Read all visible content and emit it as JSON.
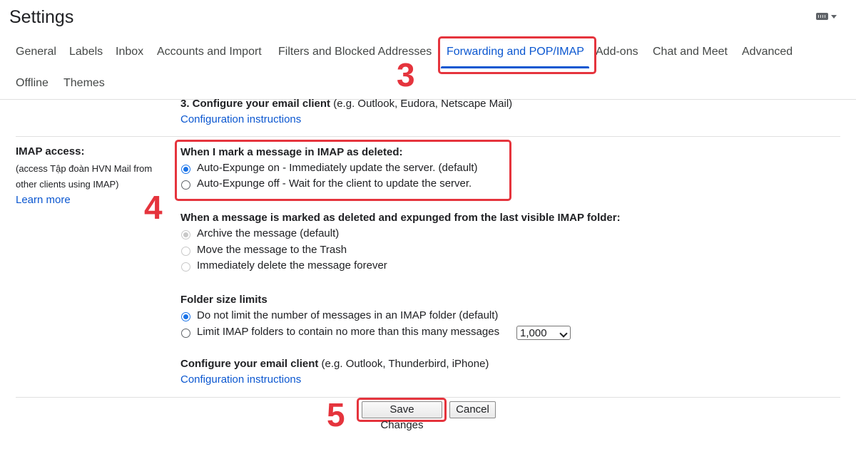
{
  "header": {
    "title": "Settings",
    "keyboard_icon": "keyboard-icon"
  },
  "tabs": [
    {
      "label": "General"
    },
    {
      "label": "Labels"
    },
    {
      "label": "Inbox"
    },
    {
      "label": "Accounts and Import"
    },
    {
      "label": "Filters and Blocked Addresses"
    },
    {
      "label": "Forwarding and POP/IMAP",
      "active": true
    },
    {
      "label": "Add-ons"
    },
    {
      "label": "Chat and Meet"
    },
    {
      "label": "Advanced"
    },
    {
      "label": "Offline"
    },
    {
      "label": "Themes"
    }
  ],
  "annotations": {
    "step3": "3",
    "step4": "4",
    "step5": "5",
    "color": "#e5343d"
  },
  "pop_section": {
    "configure_bold": "3. Configure your email client",
    "configure_rest": "(e.g. Outlook, Eudora, Netscape Mail)",
    "instructions_link": "Configuration instructions"
  },
  "imap": {
    "label": "IMAP access:",
    "description": "(access Tập đoàn HVN Mail from other clients using IMAP)",
    "learn_more": "Learn more",
    "deleted_heading": "When I mark a message in IMAP as deleted:",
    "deleted_options": [
      {
        "label": "Auto-Expunge on - Immediately update the server. (default)",
        "checked": true
      },
      {
        "label": "Auto-Expunge off - Wait for the client to update the server.",
        "checked": false
      }
    ],
    "expunged_heading": "When a message is marked as deleted and expunged from the last visible IMAP folder:",
    "expunged_options": [
      {
        "label": "Archive the message (default)",
        "checked": true,
        "disabled": true
      },
      {
        "label": "Move the message to the Trash",
        "checked": false,
        "disabled": true
      },
      {
        "label": "Immediately delete the message forever",
        "checked": false,
        "disabled": true
      }
    ],
    "folder_heading": "Folder size limits",
    "folder_options": [
      {
        "label": "Do not limit the number of messages in an IMAP folder (default)",
        "checked": true
      },
      {
        "label": "Limit IMAP folders to contain no more than this many messages",
        "checked": false
      }
    ],
    "folder_limit_value": "1,000",
    "configure_bold": "Configure your email client",
    "configure_rest": "(e.g. Outlook, Thunderbird, iPhone)",
    "instructions_link": "Configuration instructions"
  },
  "actions": {
    "save": "Save Changes",
    "cancel": "Cancel"
  }
}
